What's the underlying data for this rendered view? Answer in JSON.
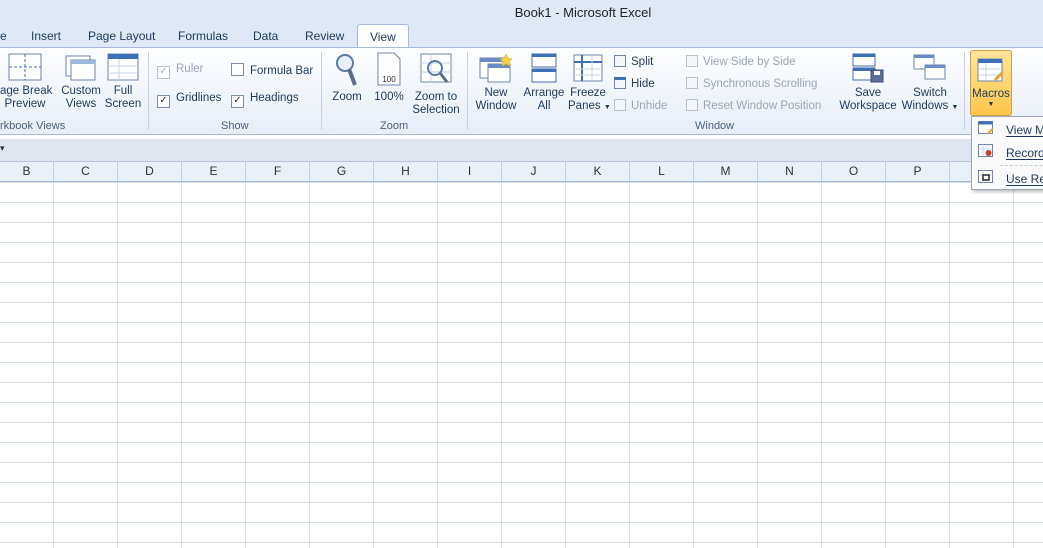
{
  "window": {
    "title": "Book1  -  Microsoft Excel"
  },
  "tabs": [
    "e",
    "Insert",
    "Page Layout",
    "Formulas",
    "Data",
    "Review",
    "View"
  ],
  "ribbon": {
    "workbook_views": {
      "group_label": "rkbook Views",
      "page_break": [
        "age Break",
        "Preview"
      ],
      "custom_views": [
        "Custom",
        "Views"
      ],
      "full_screen": [
        "Full",
        "Screen"
      ]
    },
    "show": {
      "group_label": "Show",
      "ruler": "Ruler",
      "formula_bar": "Formula Bar",
      "gridlines": "Gridlines",
      "headings": "Headings",
      "ruler_checked": true,
      "formula_bar_checked": false,
      "gridlines_checked": true,
      "headings_checked": true
    },
    "zoom": {
      "group_label": "Zoom",
      "zoom": "Zoom",
      "hundred": "100%",
      "zoom_selection": [
        "Zoom to",
        "Selection"
      ]
    },
    "window": {
      "group_label": "Window",
      "new_window": [
        "New",
        "Window"
      ],
      "arrange_all": [
        "Arrange",
        "All"
      ],
      "freeze_panes": [
        "Freeze",
        "Panes"
      ],
      "split": "Split",
      "hide": "Hide",
      "unhide": "Unhide",
      "view_side_by_side": "View Side by Side",
      "sync_scrolling": "Synchronous Scrolling",
      "reset_position": "Reset Window Position",
      "save_workspace": [
        "Save",
        "Workspace"
      ],
      "switch_windows": [
        "Switch",
        "Windows"
      ]
    },
    "macros": {
      "label": "Macros"
    }
  },
  "formula_bar": {
    "name_box_tail": "▾"
  },
  "columns": [
    "B",
    "C",
    "D",
    "E",
    "F",
    "G",
    "H",
    "I",
    "J",
    "K",
    "L",
    "M",
    "N",
    "O",
    "P",
    ""
  ],
  "macros_menu": {
    "items": [
      "View M",
      "Record",
      "Use Rel"
    ]
  },
  "colors": {
    "accent": "#ffc64a",
    "ribbon_bg": "#e7eef8",
    "gridline": "#d9dee6"
  }
}
